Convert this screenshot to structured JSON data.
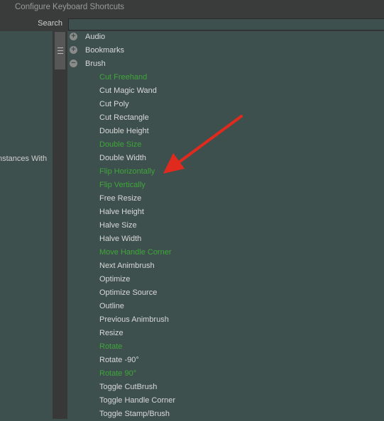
{
  "window": {
    "title": "Configure Keyboard Shortcuts"
  },
  "search": {
    "label": "Search",
    "value": ""
  },
  "left_panel": {
    "label": "nstances With"
  },
  "colors": {
    "assigned": "#3ea63a",
    "unassigned": "#d8d8d8",
    "annotation_arrow": "#e02a1e"
  },
  "categories": [
    {
      "label": "Audio",
      "state": "collapsed",
      "icon": "plus-circle-icon"
    },
    {
      "label": "Bookmarks",
      "state": "collapsed",
      "icon": "plus-circle-icon"
    },
    {
      "label": "Brush",
      "state": "expanded",
      "icon": "minus-circle-icon"
    }
  ],
  "brush_items": [
    {
      "label": "Cut Freehand",
      "assigned": true
    },
    {
      "label": "Cut Magic Wand",
      "assigned": false
    },
    {
      "label": "Cut Poly",
      "assigned": false
    },
    {
      "label": "Cut Rectangle",
      "assigned": false
    },
    {
      "label": "Double Height",
      "assigned": false
    },
    {
      "label": "Double Size",
      "assigned": true
    },
    {
      "label": "Double Width",
      "assigned": false
    },
    {
      "label": "Flip Horizontally",
      "assigned": true
    },
    {
      "label": "Flip Vertically",
      "assigned": true
    },
    {
      "label": "Free Resize",
      "assigned": false
    },
    {
      "label": "Halve Height",
      "assigned": false
    },
    {
      "label": "Halve Size",
      "assigned": false
    },
    {
      "label": "Halve Width",
      "assigned": false
    },
    {
      "label": "Move Handle Corner",
      "assigned": true
    },
    {
      "label": "Next Animbrush",
      "assigned": false
    },
    {
      "label": "Optimize",
      "assigned": false
    },
    {
      "label": "Optimize Source",
      "assigned": false
    },
    {
      "label": "Outline",
      "assigned": false
    },
    {
      "label": "Previous Animbrush",
      "assigned": false
    },
    {
      "label": "Resize",
      "assigned": false
    },
    {
      "label": "Rotate",
      "assigned": true
    },
    {
      "label": "Rotate -90°",
      "assigned": false
    },
    {
      "label": "Rotate 90°",
      "assigned": true
    },
    {
      "label": "Toggle CutBrush",
      "assigned": false
    },
    {
      "label": "Toggle Handle Corner",
      "assigned": false
    },
    {
      "label": "Toggle Stamp/Brush",
      "assigned": false
    }
  ]
}
